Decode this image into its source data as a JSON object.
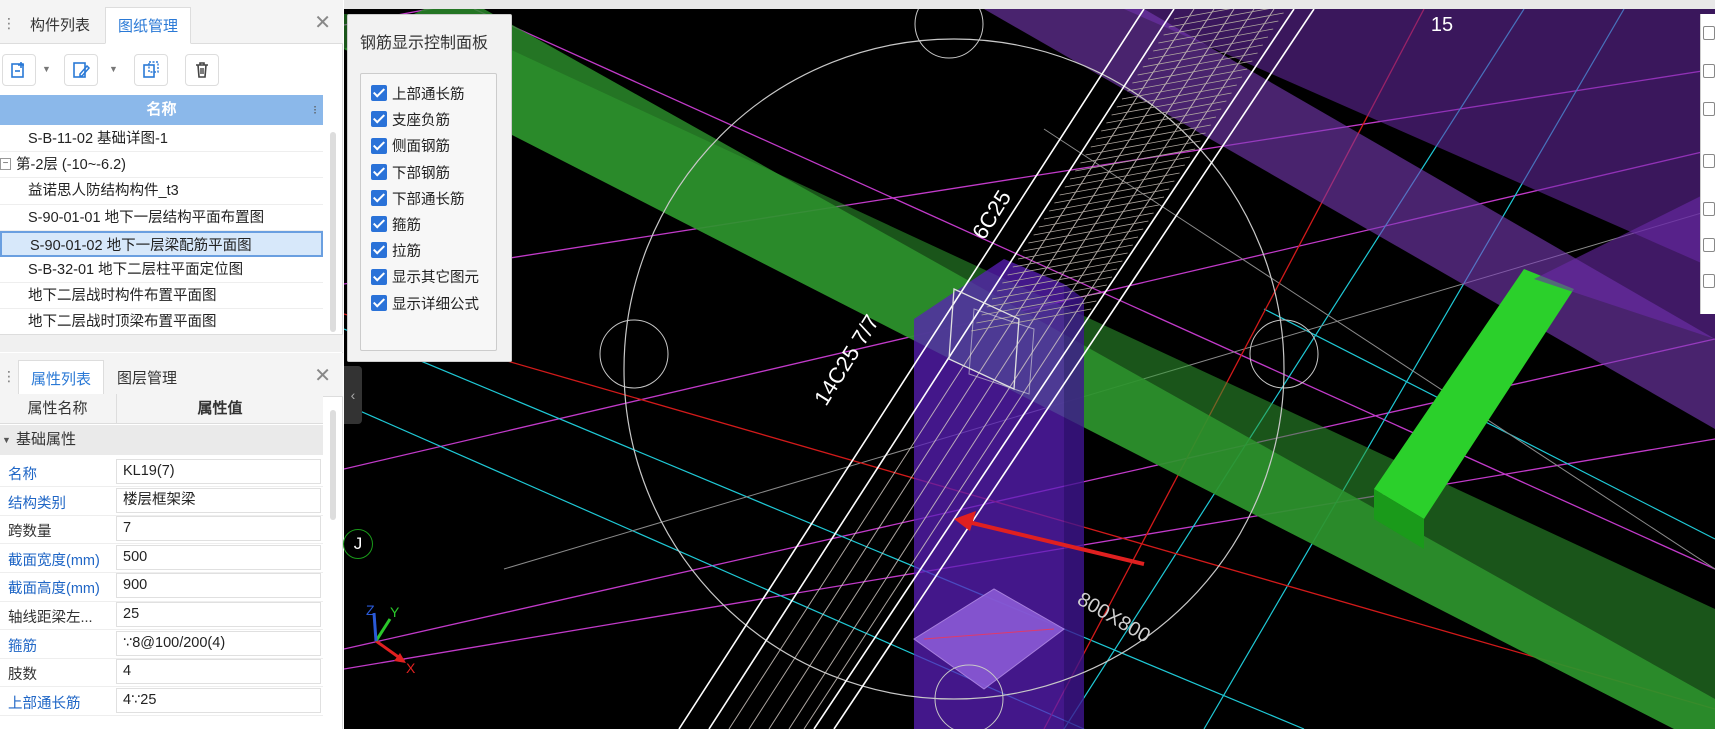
{
  "drawing_panel": {
    "tabs": [
      "构件列表",
      "图纸管理"
    ],
    "active_tab": 1,
    "column_header": "名称",
    "rows": [
      {
        "label": "S-B-11-02 基础详图-1",
        "type": "item"
      },
      {
        "label": "第-2层 (-10~-6.2)",
        "type": "group"
      },
      {
        "label": "益诺思人防结构构件_t3",
        "type": "item"
      },
      {
        "label": "S-90-01-01 地下一层结构平面布置图",
        "type": "item"
      },
      {
        "label": "S-90-01-02 地下一层梁配筋平面图",
        "type": "item",
        "selected": true
      },
      {
        "label": "S-B-32-01 地下二层柱平面定位图",
        "type": "item"
      },
      {
        "label": "地下二层战时构件布置平面图",
        "type": "item"
      },
      {
        "label": "地下二层战时顶梁布置平面图",
        "type": "item"
      }
    ]
  },
  "property_panel": {
    "tabs": [
      "属性列表",
      "图层管理"
    ],
    "active_tab": 0,
    "col_name": "属性名称",
    "col_value": "属性值",
    "section": "基础属性",
    "rows": [
      {
        "name": "名称",
        "value": "KL19(7)",
        "blue": true
      },
      {
        "name": "结构类别",
        "value": "楼层框架梁",
        "blue": true
      },
      {
        "name": "跨数量",
        "value": "7",
        "blue": false
      },
      {
        "name": "截面宽度(mm)",
        "value": "500",
        "blue": true
      },
      {
        "name": "截面高度(mm)",
        "value": "900",
        "blue": true
      },
      {
        "name": "轴线距梁左...",
        "value": "25",
        "blue": false
      },
      {
        "name": "箍筋",
        "value": "∵8@100/200(4)",
        "blue": true
      },
      {
        "name": "肢数",
        "value": "4",
        "blue": false
      },
      {
        "name": "上部通长筋",
        "value": "4∵25",
        "blue": true
      }
    ]
  },
  "rebar_control": {
    "title": "钢筋显示控制面板",
    "options": [
      "上部通长筋",
      "支座负筋",
      "侧面钢筋",
      "下部钢筋",
      "下部通长筋",
      "箍筋",
      "拉筋",
      "显示其它图元",
      "显示详细公式"
    ]
  },
  "viewport": {
    "labels": {
      "axis_15": "15",
      "axis_J": "J",
      "rebar_top": "6C25",
      "rebar_side": "14C25 7/7",
      "column_size": "800X800"
    },
    "axes": {
      "x": "X",
      "y": "Y",
      "z": "Z"
    },
    "colors": {
      "beam": "#2a8a2a",
      "column": "#7a2fcf",
      "grid_magenta": "#c13ac9",
      "grid_cyan": "#1fc9d6",
      "grid_red": "#d21a1a",
      "arrow": "#e02020"
    }
  },
  "icons": {
    "close": "close-icon",
    "toolbar": [
      "add-drawing-icon",
      "edit-drawing-icon",
      "split-drawing-icon",
      "delete-icon"
    ]
  }
}
